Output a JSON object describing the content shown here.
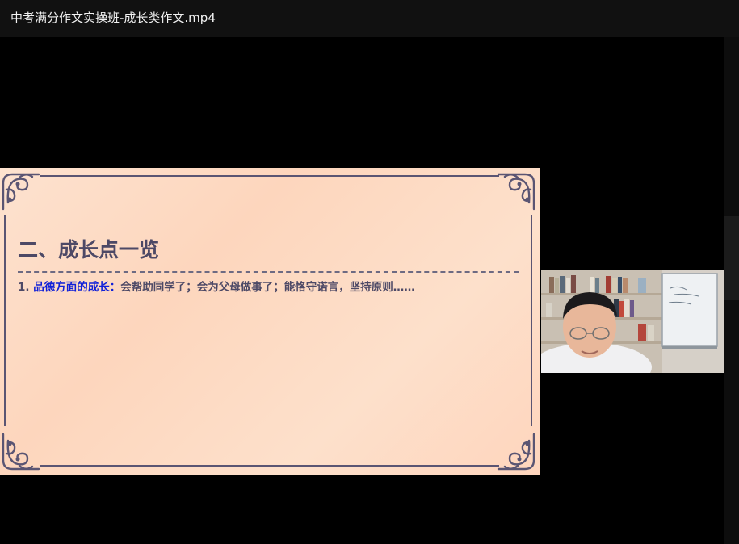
{
  "window": {
    "title": "中考满分作文实操班-成长类作文.mp4"
  },
  "slide": {
    "heading": "二、成长点一览",
    "item_number": "1.",
    "item_keyword": "品德方面的成长：",
    "item_text": "会帮助同学了；会为父母做事了；能恪守诺言，坚持原则……"
  },
  "colors": {
    "titlebar_bg": "#111111",
    "slide_heading": "#4d4966",
    "slide_keyword": "#1020d8",
    "frame": "#5a5573"
  },
  "icons": {
    "corner_ornament": "scroll-ornament-icon"
  }
}
